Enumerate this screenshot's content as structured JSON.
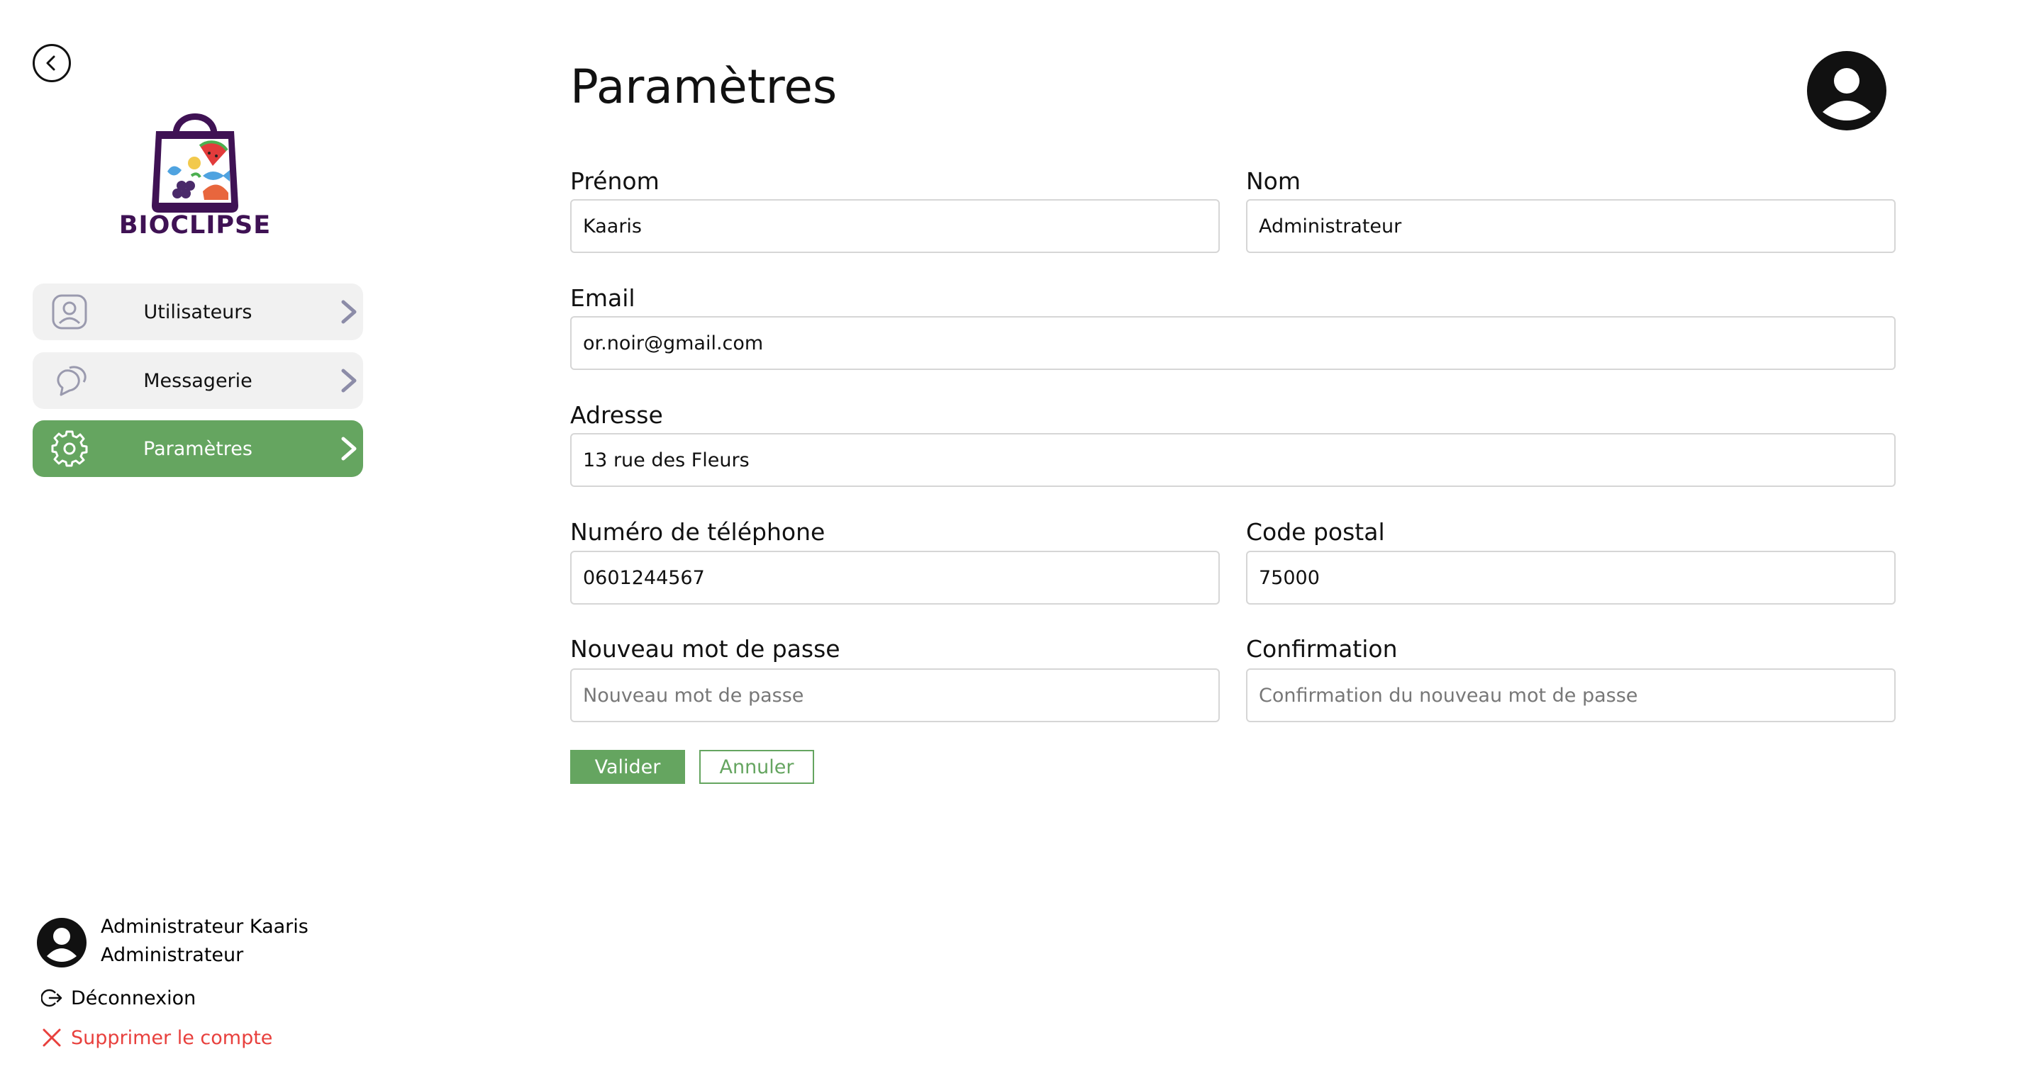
{
  "app": {
    "brand": "BIOCLIPSE",
    "colors": {
      "accent": "#65a560",
      "brand": "#3f1254",
      "danger": "#e8403d"
    }
  },
  "sidebar": {
    "back_icon": "chevron-left-icon",
    "items": [
      {
        "label": "Utilisateurs",
        "icon": "user-icon",
        "active": false
      },
      {
        "label": "Messagerie",
        "icon": "chat-icon",
        "active": false
      },
      {
        "label": "Paramètres",
        "icon": "gear-icon",
        "active": true
      }
    ],
    "user": {
      "name": "Administrateur Kaaris",
      "role": "Administrateur",
      "logout_label": "Déconnexion",
      "delete_label": "Supprimer le compte"
    }
  },
  "main": {
    "title": "Paramètres",
    "form": {
      "prenom": {
        "label": "Prénom",
        "value": "Kaaris",
        "placeholder": ""
      },
      "nom": {
        "label": "Nom",
        "value": "Administrateur",
        "placeholder": ""
      },
      "email": {
        "label": "Email",
        "value": "or.noir@gmail.com",
        "placeholder": ""
      },
      "adresse": {
        "label": "Adresse",
        "value": "13 rue des Fleurs",
        "placeholder": ""
      },
      "telephone": {
        "label": "Numéro de téléphone",
        "value": "0601244567",
        "placeholder": ""
      },
      "code_postal": {
        "label": "Code postal",
        "value": "75000",
        "placeholder": ""
      },
      "nouveau_mdp": {
        "label": "Nouveau mot de passe",
        "value": "",
        "placeholder": "Nouveau mot de passe"
      },
      "confirmation": {
        "label": "Confirmation",
        "value": "",
        "placeholder": "Confirmation du nouveau mot de passe"
      }
    },
    "buttons": {
      "submit": "Valider",
      "cancel": "Annuler"
    }
  }
}
